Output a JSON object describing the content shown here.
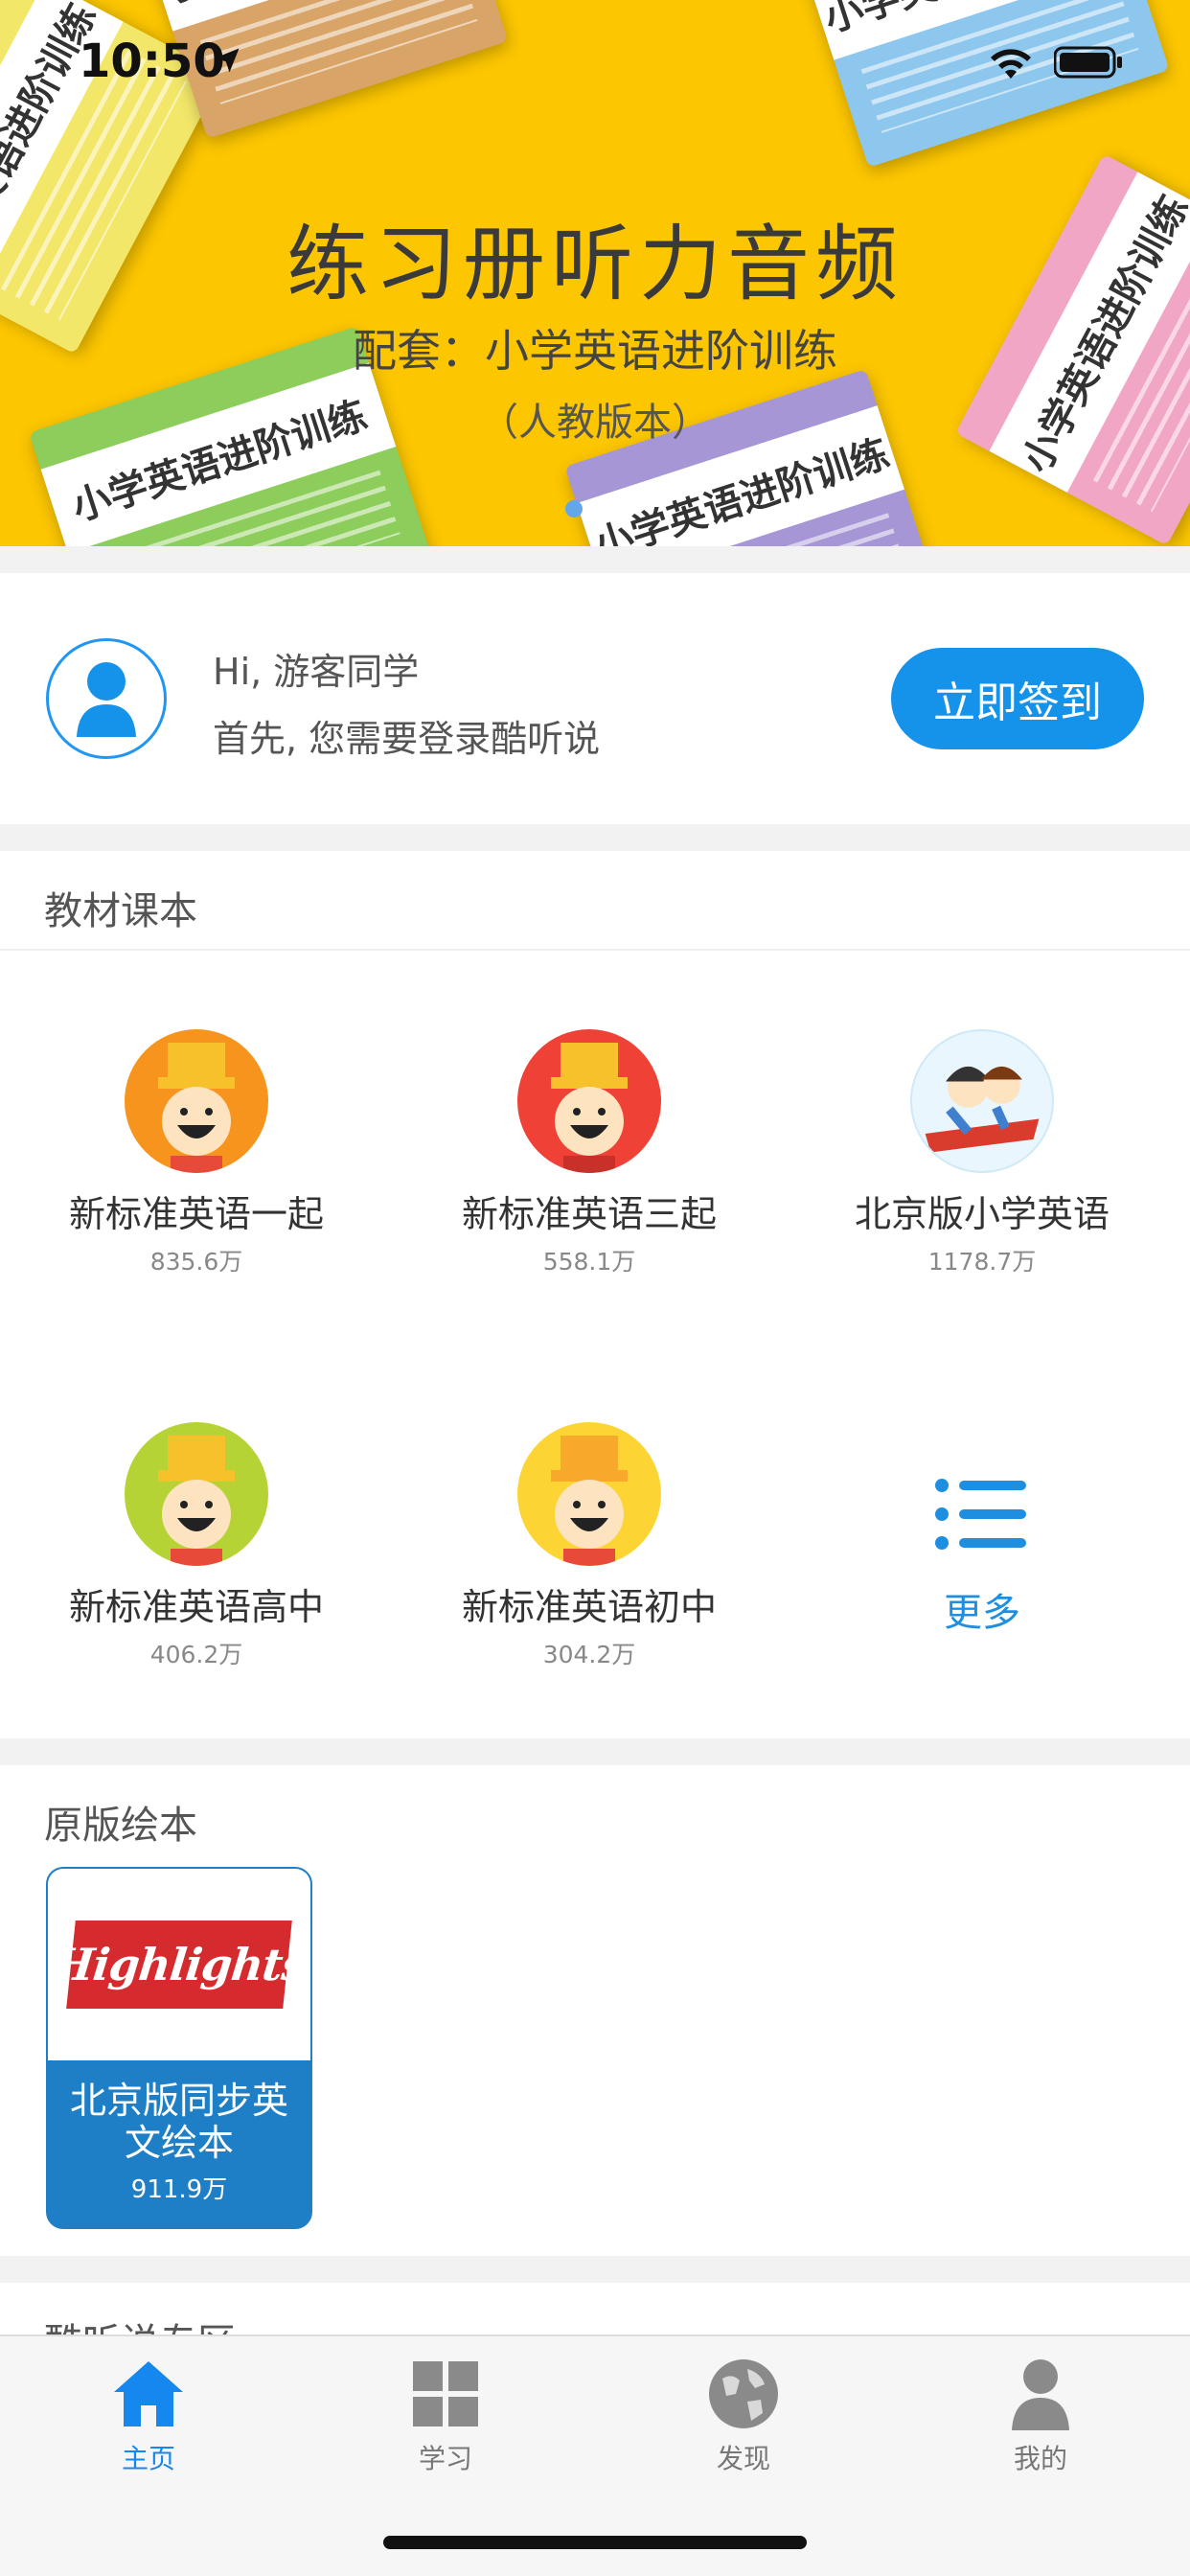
{
  "status_bar": {
    "time": "10:50",
    "icons": [
      "location-arrow-icon",
      "wifi-icon",
      "battery-icon"
    ]
  },
  "banner": {
    "title": "练习册听力音频",
    "subtitle": "配套：小学英语进阶训练",
    "subtitle2": "（人教版本）",
    "book_cover_text": "小学英语进阶训练",
    "page_count": 2,
    "active_page": 1,
    "background_color": "#fcc600"
  },
  "login_card": {
    "greeting": "Hi, 游客同学",
    "hint": "首先, 您需要登录酷听说",
    "signin_button": "立即签到",
    "accent_color": "#1592ea"
  },
  "textbooks": {
    "section_title": "教材课本",
    "items": [
      {
        "name": "新标准英语一起",
        "count": "835.6万",
        "icon": "mascot-orange-icon",
        "color": "#f7941d"
      },
      {
        "name": "新标准英语三起",
        "count": "558.1万",
        "icon": "mascot-red-icon",
        "color": "#ef4136"
      },
      {
        "name": "北京版小学英语",
        "count": "1178.7万",
        "icon": "kids-flying-carpet-icon",
        "color": "#7ec8f2"
      },
      {
        "name": "新标准英语高中",
        "count": "406.2万",
        "icon": "mascot-green-icon",
        "color": "#b5d334"
      },
      {
        "name": "新标准英语初中",
        "count": "304.2万",
        "icon": "mascot-yellow-icon",
        "color": "#fcd535"
      }
    ],
    "more_label": "更多"
  },
  "picture_books": {
    "section_title": "原版绘本",
    "items": [
      {
        "logo_text": "Highlights",
        "name": "北京版同步英文绘本",
        "count": "911.9万"
      }
    ]
  },
  "zone": {
    "section_title": "酷听说专区"
  },
  "tab_bar": {
    "tabs": [
      {
        "label": "主页",
        "icon": "home-icon",
        "active": true
      },
      {
        "label": "学习",
        "icon": "grid-icon",
        "active": false
      },
      {
        "label": "发现",
        "icon": "globe-icon",
        "active": false
      },
      {
        "label": "我的",
        "icon": "user-icon",
        "active": false
      }
    ],
    "active_color": "#1587ee"
  }
}
